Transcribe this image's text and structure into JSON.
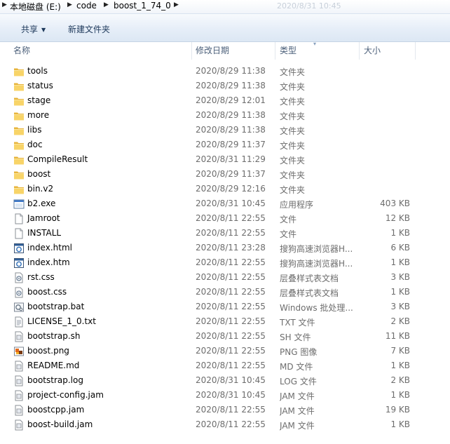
{
  "breadcrumb": {
    "items": [
      "本地磁盘 (E:)",
      "code",
      "boost_1_74_0"
    ],
    "overlay_text": "2020/8/31 10:45"
  },
  "toolbar": {
    "share_label": "共享",
    "new_folder_label": "新建文件夹"
  },
  "columns": {
    "name": "名称",
    "date": "修改日期",
    "type": "类型",
    "size": "大小"
  },
  "files": [
    {
      "name": "tools",
      "date": "2020/8/29 11:38",
      "type": "文件夹",
      "size": "",
      "icon": "folder-icon"
    },
    {
      "name": "status",
      "date": "2020/8/29 11:38",
      "type": "文件夹",
      "size": "",
      "icon": "folder-icon"
    },
    {
      "name": "stage",
      "date": "2020/8/29 12:01",
      "type": "文件夹",
      "size": "",
      "icon": "folder-icon"
    },
    {
      "name": "more",
      "date": "2020/8/29 11:38",
      "type": "文件夹",
      "size": "",
      "icon": "folder-icon"
    },
    {
      "name": "libs",
      "date": "2020/8/29 11:38",
      "type": "文件夹",
      "size": "",
      "icon": "folder-icon"
    },
    {
      "name": "doc",
      "date": "2020/8/29 11:37",
      "type": "文件夹",
      "size": "",
      "icon": "folder-icon"
    },
    {
      "name": "CompileResult",
      "date": "2020/8/31 11:29",
      "type": "文件夹",
      "size": "",
      "icon": "folder-icon"
    },
    {
      "name": "boost",
      "date": "2020/8/29 11:37",
      "type": "文件夹",
      "size": "",
      "icon": "folder-icon"
    },
    {
      "name": "bin.v2",
      "date": "2020/8/29 12:16",
      "type": "文件夹",
      "size": "",
      "icon": "folder-icon"
    },
    {
      "name": "b2.exe",
      "date": "2020/8/31 10:45",
      "type": "应用程序",
      "size": "403 KB",
      "icon": "exe-icon"
    },
    {
      "name": "Jamroot",
      "date": "2020/8/11 22:55",
      "type": "文件",
      "size": "12 KB",
      "icon": "blank-file-icon"
    },
    {
      "name": "INSTALL",
      "date": "2020/8/11 22:55",
      "type": "文件",
      "size": "1 KB",
      "icon": "blank-file-icon"
    },
    {
      "name": "index.html",
      "date": "2020/8/11 23:28",
      "type": "搜狗高速浏览器H...",
      "size": "6 KB",
      "icon": "html-file-icon"
    },
    {
      "name": "index.htm",
      "date": "2020/8/11 22:55",
      "type": "搜狗高速浏览器H...",
      "size": "1 KB",
      "icon": "html-file-icon"
    },
    {
      "name": "rst.css",
      "date": "2020/8/11 22:55",
      "type": "层叠样式表文档",
      "size": "3 KB",
      "icon": "css-file-icon"
    },
    {
      "name": "boost.css",
      "date": "2020/8/11 22:55",
      "type": "层叠样式表文档",
      "size": "1 KB",
      "icon": "css-file-icon"
    },
    {
      "name": "bootstrap.bat",
      "date": "2020/8/11 22:55",
      "type": "Windows 批处理...",
      "size": "3 KB",
      "icon": "bat-file-icon"
    },
    {
      "name": "LICENSE_1_0.txt",
      "date": "2020/8/11 22:55",
      "type": "TXT 文件",
      "size": "2 KB",
      "icon": "text-file-icon"
    },
    {
      "name": "bootstrap.sh",
      "date": "2020/8/11 22:55",
      "type": "SH 文件",
      "size": "11 KB",
      "icon": "script-file-icon"
    },
    {
      "name": "boost.png",
      "date": "2020/8/11 22:55",
      "type": "PNG 图像",
      "size": "7 KB",
      "icon": "image-file-icon"
    },
    {
      "name": "README.md",
      "date": "2020/8/11 22:55",
      "type": "MD 文件",
      "size": "1 KB",
      "icon": "script-file-icon"
    },
    {
      "name": "bootstrap.log",
      "date": "2020/8/31 10:45",
      "type": "LOG 文件",
      "size": "2 KB",
      "icon": "script-file-icon"
    },
    {
      "name": "project-config.jam",
      "date": "2020/8/31 10:45",
      "type": "JAM 文件",
      "size": "1 KB",
      "icon": "script-file-icon"
    },
    {
      "name": "boostcpp.jam",
      "date": "2020/8/11 22:55",
      "type": "JAM 文件",
      "size": "19 KB",
      "icon": "script-file-icon"
    },
    {
      "name": "boost-build.jam",
      "date": "2020/8/11 22:55",
      "type": "JAM 文件",
      "size": "1 KB",
      "icon": "script-file-icon"
    }
  ]
}
